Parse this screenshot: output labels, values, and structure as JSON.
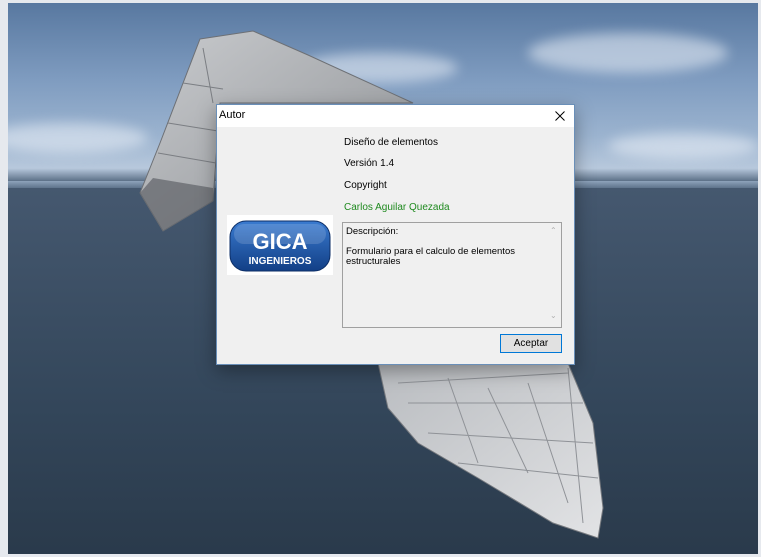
{
  "dialog": {
    "title": "Autor",
    "close_icon": "close-icon",
    "product_name": "Diseño de elementos",
    "version": "Versión 1.4",
    "copyright": "Copyright",
    "author": "Carlos Aguilar Quezada",
    "description": "Descripción:\n\nFormulario para el calculo de elementos\nestructurales",
    "accept_label": "Aceptar",
    "logo": {
      "line1": "GICA",
      "line2": "INGENIEROS",
      "color": "#1c5aa8"
    },
    "author_color": "#1f8a1f",
    "accent_color": "#0078d7"
  }
}
